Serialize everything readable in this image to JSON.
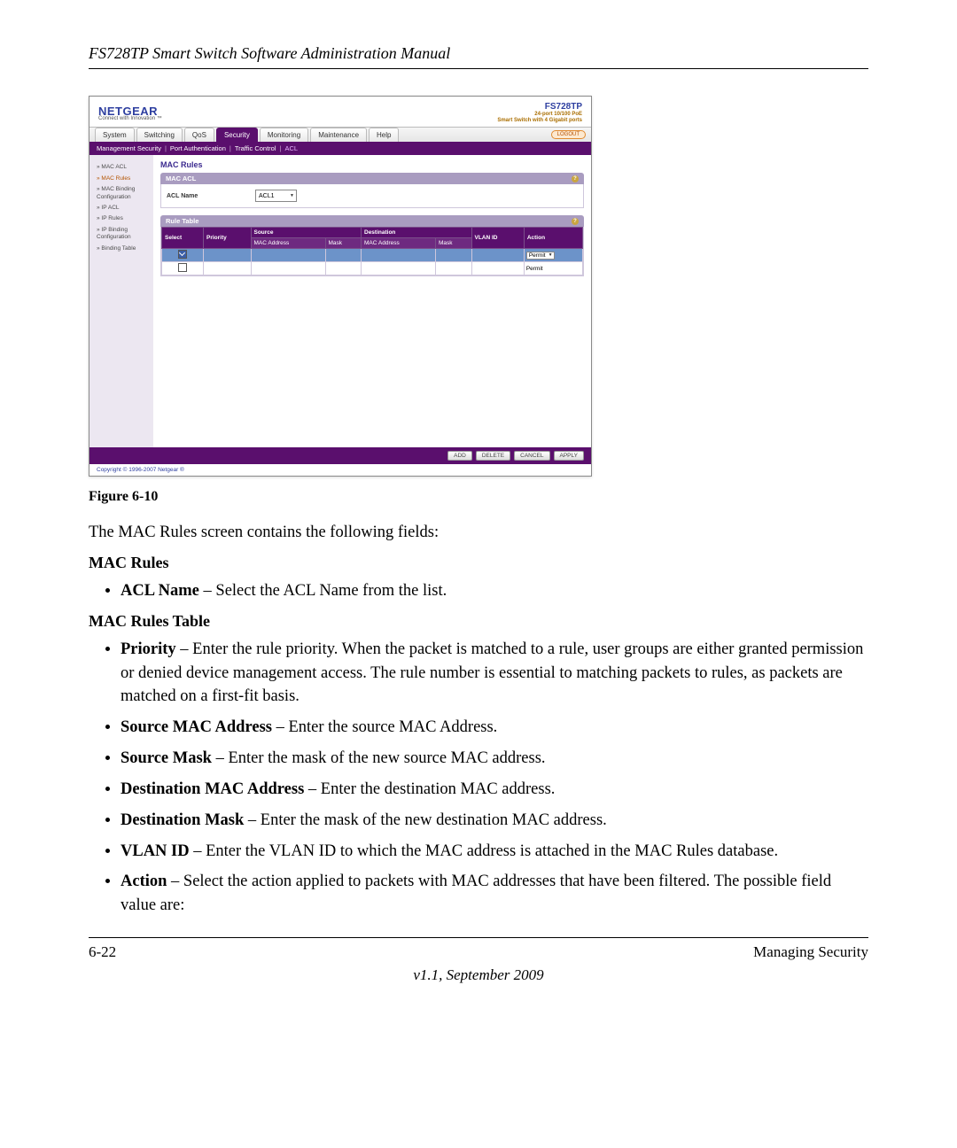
{
  "doc": {
    "header": "FS728TP Smart Switch Software Administration Manual",
    "figure_label": "Figure 6-10",
    "intro": "The MAC Rules screen contains the following fields:",
    "section1_heading": "MAC Rules",
    "section1_item_term": "ACL Name",
    "section1_item_desc": " – Select the ACL Name from the list.",
    "section2_heading": "MAC Rules Table",
    "fields": [
      {
        "term": "Priority",
        "desc": " – Enter the rule priority. When the packet is matched to a rule, user groups are either granted permission or denied device management access. The rule number is essential to matching packets to rules, as packets are matched on a first-fit basis."
      },
      {
        "term": "Source MAC Address",
        "desc": " – Enter the source MAC Address."
      },
      {
        "term": "Source Mask",
        "desc": " – Enter the mask of the new source MAC address."
      },
      {
        "term": "Destination MAC Address",
        "desc": " – Enter the destination MAC address."
      },
      {
        "term": "Destination Mask",
        "desc": " – Enter the mask of the new destination MAC address."
      },
      {
        "term": "VLAN ID",
        "desc": " – Enter the VLAN ID to which the MAC address is attached in the MAC Rules database."
      },
      {
        "term": "Action",
        "desc": " – Select the action applied to packets with MAC addresses that have been filtered. The possible field value are:"
      }
    ],
    "footer_left": "6-22",
    "footer_right": "Managing Security",
    "footer_version": "v1.1, September 2009"
  },
  "ui": {
    "brand": "NETGEAR",
    "brand_tag": "Connect with Innovation ™",
    "model": "FS728TP",
    "model_sub1": "24-port 10/100 PoE",
    "model_sub2": "Smart Switch with 4 Gigabit ports",
    "logout": "LOGOUT",
    "tabs": [
      "System",
      "Switching",
      "QoS",
      "Security",
      "Monitoring",
      "Maintenance",
      "Help"
    ],
    "active_tab": "Security",
    "subnav": [
      "Management Security",
      "Port Authentication",
      "Traffic Control",
      "ACL"
    ],
    "subnav_active": "ACL",
    "side": [
      {
        "label": "MAC ACL",
        "active": false
      },
      {
        "label": "MAC Rules",
        "active": true
      },
      {
        "label": "MAC Binding Configuration",
        "active": false
      },
      {
        "label": "IP ACL",
        "active": false
      },
      {
        "label": "IP Rules",
        "active": false
      },
      {
        "label": "IP Binding Configuration",
        "active": false
      },
      {
        "label": "Binding Table",
        "active": false
      }
    ],
    "main_title": "MAC Rules",
    "panel1_title": "MAC ACL",
    "acl_label": "ACL Name",
    "acl_value": "ACL1",
    "panel2_title": "Rule Table",
    "cols": {
      "select": "Select",
      "priority": "Priority",
      "source": "Source",
      "destination": "Destination",
      "vlan": "VLAN ID",
      "action": "Action",
      "mac": "MAC Address",
      "mask": "Mask"
    },
    "action_option": "Permit",
    "footer_buttons": [
      "ADD",
      "DELETE",
      "CANCEL",
      "APPLY"
    ],
    "copyright": "Copyright © 1996-2007 Netgear ®"
  }
}
